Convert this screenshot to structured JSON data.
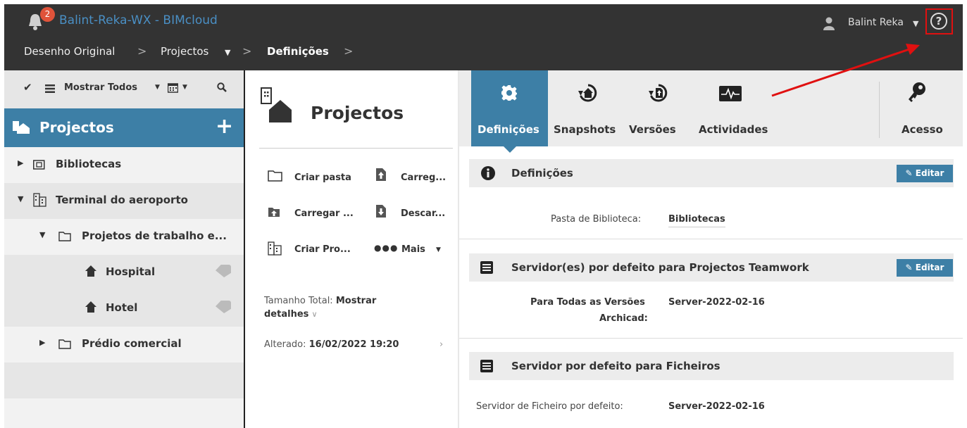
{
  "app": {
    "title": "Balint-Reka-WX - BIMcloud",
    "notifications": "2"
  },
  "user": {
    "name": "Balint Reka"
  },
  "breadcrumb": {
    "item1": "Desenho Original",
    "item2": "Projectos",
    "item3": "Definições",
    "sep": ">"
  },
  "left_toolbar": {
    "filter": "Mostrar Todos"
  },
  "left": {
    "header": "Projectos",
    "tree": [
      {
        "label": "Bibliotecas"
      },
      {
        "label": "Terminal do aeroporto"
      },
      {
        "label": "Projetos de trabalho e..."
      },
      {
        "label": "Hospital"
      },
      {
        "label": "Hotel"
      },
      {
        "label": "Prédio comercial"
      }
    ]
  },
  "middle": {
    "title": "Projectos",
    "actions": {
      "criar_pasta": "Criar pasta",
      "carreg": "Carreg...",
      "carregar": "Carregar ...",
      "descar": "Descar...",
      "criar_pro": "Criar Pro...",
      "mais": "Mais"
    },
    "size_label": "Tamanho Total:",
    "size_value_1": "Mostrar",
    "size_value_2": "detalhes",
    "changed_label": "Alterado:",
    "changed_value": "16/02/2022 19:20"
  },
  "tabs": {
    "definicoes": "Definições",
    "snapshots": "Snapshots",
    "versoes": "Versões",
    "actividades": "Actividades",
    "acesso": "Acesso"
  },
  "sections": {
    "defs": {
      "title": "Definições",
      "edit": "Editar",
      "lib_label": "Pasta de Biblioteca:",
      "lib_value": "Bibliotecas"
    },
    "servers": {
      "title": "Servidor(es) por defeito para Projectos Teamwork",
      "edit": "Editar",
      "label_1": "Para Todas as Versões",
      "label_2": "Archicad:",
      "value": "Server-2022-02-16"
    },
    "files": {
      "title": "Servidor por defeito para Ficheiros",
      "label": "Servidor de Ficheiro por defeito:",
      "value": "Server-2022-02-16"
    }
  },
  "colors": {
    "accent": "#3d7fa6",
    "topbar": "#333333",
    "highlight": "#e01010",
    "badge": "#e0533a"
  }
}
